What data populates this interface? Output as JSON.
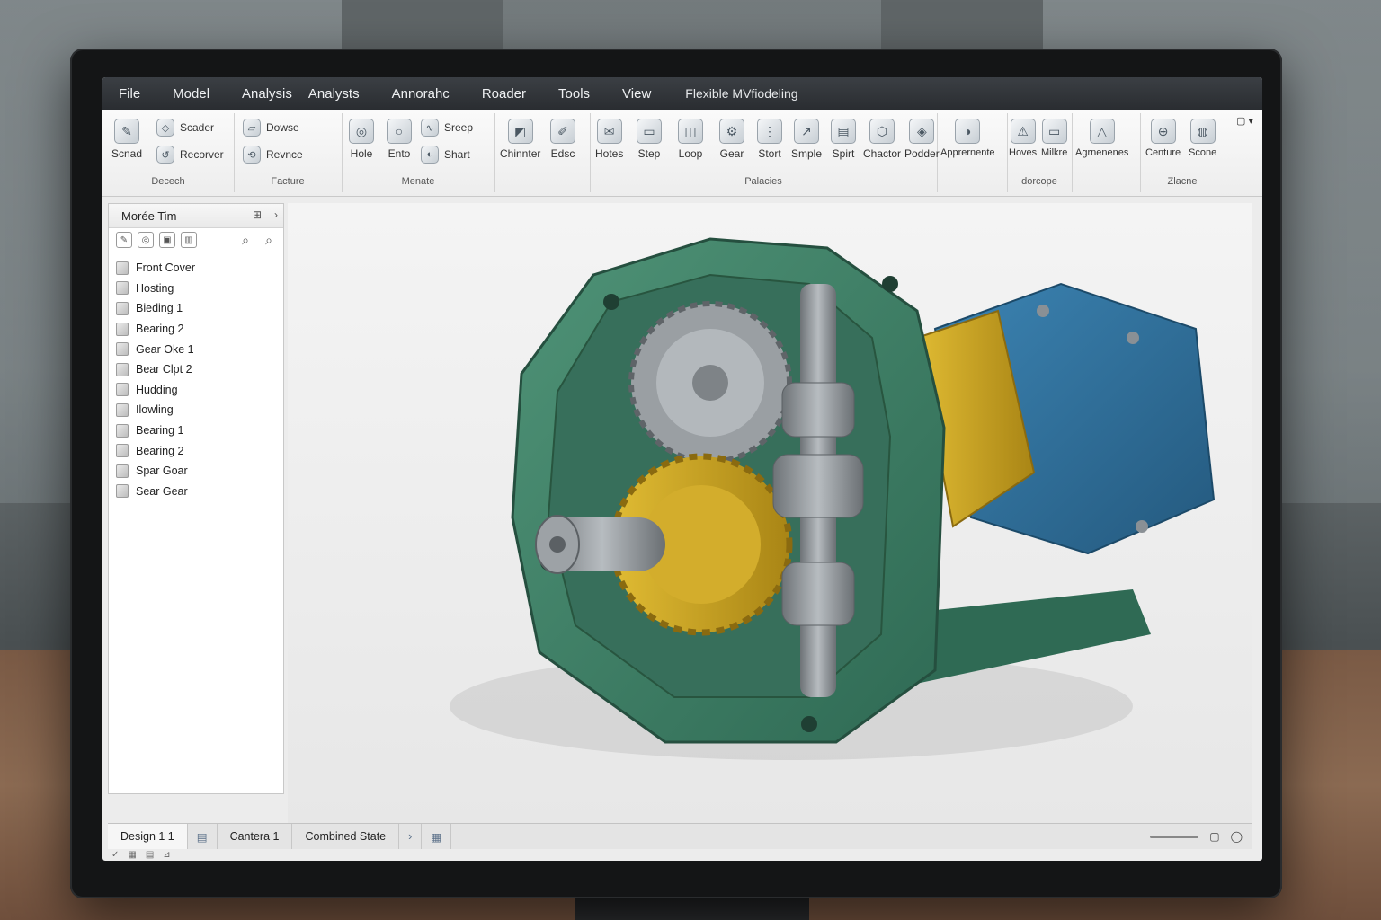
{
  "menubar": {
    "items": [
      "File",
      "Model",
      "Analysis",
      "Analysts",
      "Annorahc",
      "Roader",
      "Tools",
      "View"
    ],
    "title": "Flexible MVfiodeling"
  },
  "ribbon": {
    "window_controls": "▢ ▾",
    "groups": [
      {
        "label": "Decech",
        "tools": [
          "Scnad",
          "Scader",
          "Recorver"
        ]
      },
      {
        "label": "Facture",
        "tools": [
          "Dowse",
          "Revnce"
        ]
      },
      {
        "label": "Menate",
        "tools": [
          "Hole",
          "Ento",
          "Sreep",
          "Shart"
        ]
      },
      {
        "label": "",
        "tools": [
          "Chinnter",
          "Edsc"
        ]
      },
      {
        "label": "Palacies",
        "tools": [
          "Hotes",
          "Step",
          "Loop",
          "Gear",
          "Stort",
          "Smple",
          "Spirt",
          "Chactor",
          "Podder"
        ]
      },
      {
        "label": "",
        "tools": [
          "Apprernente"
        ]
      },
      {
        "label": "dorcope",
        "tools": [
          "Hoves",
          "Milkre"
        ]
      },
      {
        "label": "",
        "tools": [
          "Agrnenenes"
        ]
      },
      {
        "label": "Zlacne",
        "tools": [
          "Centure",
          "Scone"
        ]
      }
    ]
  },
  "sidebar": {
    "title": "Morée Tim",
    "items": [
      "Front Cover",
      "Hosting",
      "Bieding 1",
      "Bearing 2",
      "Gear Oke 1",
      "Bear Clpt 2",
      "Hudding",
      "Ilowling",
      "Bearing 1",
      "Bearing 2",
      "Spar Goar",
      "Sear Gear"
    ]
  },
  "tabs": {
    "items": [
      "Design 1 1",
      "Cantera 1",
      "Combined State"
    ]
  },
  "colors": {
    "housing": "#3f7f66",
    "gear_yellow": "#c9a526",
    "motor_blue": "#2f6f9a",
    "shaft_grey": "#8d9296"
  }
}
